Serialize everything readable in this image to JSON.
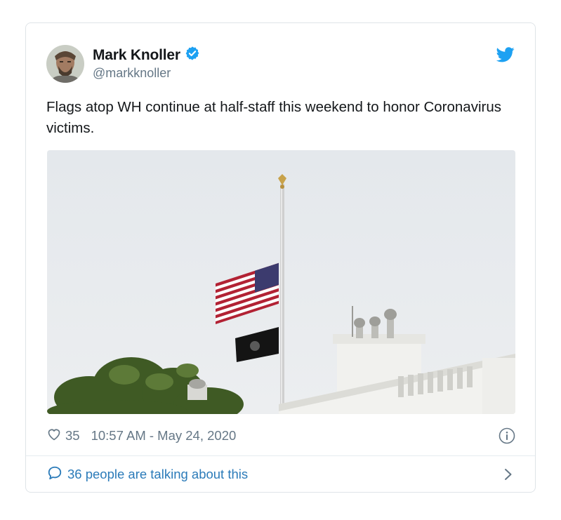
{
  "tweet": {
    "author_name": "Mark Knoller",
    "handle": "@markknoller",
    "text": "Flags atop WH continue at half-staff this weekend to honor Coronavirus victims.",
    "likes": "35",
    "timestamp": "10:57 AM - May 24, 2020",
    "conversation_label": "36 people are talking about this"
  },
  "icons": {
    "verified": "verified-badge-icon",
    "brand": "twitter-bird-icon",
    "like": "heart-icon",
    "info": "info-icon",
    "reply": "speech-bubble-icon",
    "more": "chevron-right-icon"
  },
  "colors": {
    "accent": "#1da1f2",
    "link": "#2b7bb9",
    "text": "#14171a",
    "muted": "#657786"
  }
}
